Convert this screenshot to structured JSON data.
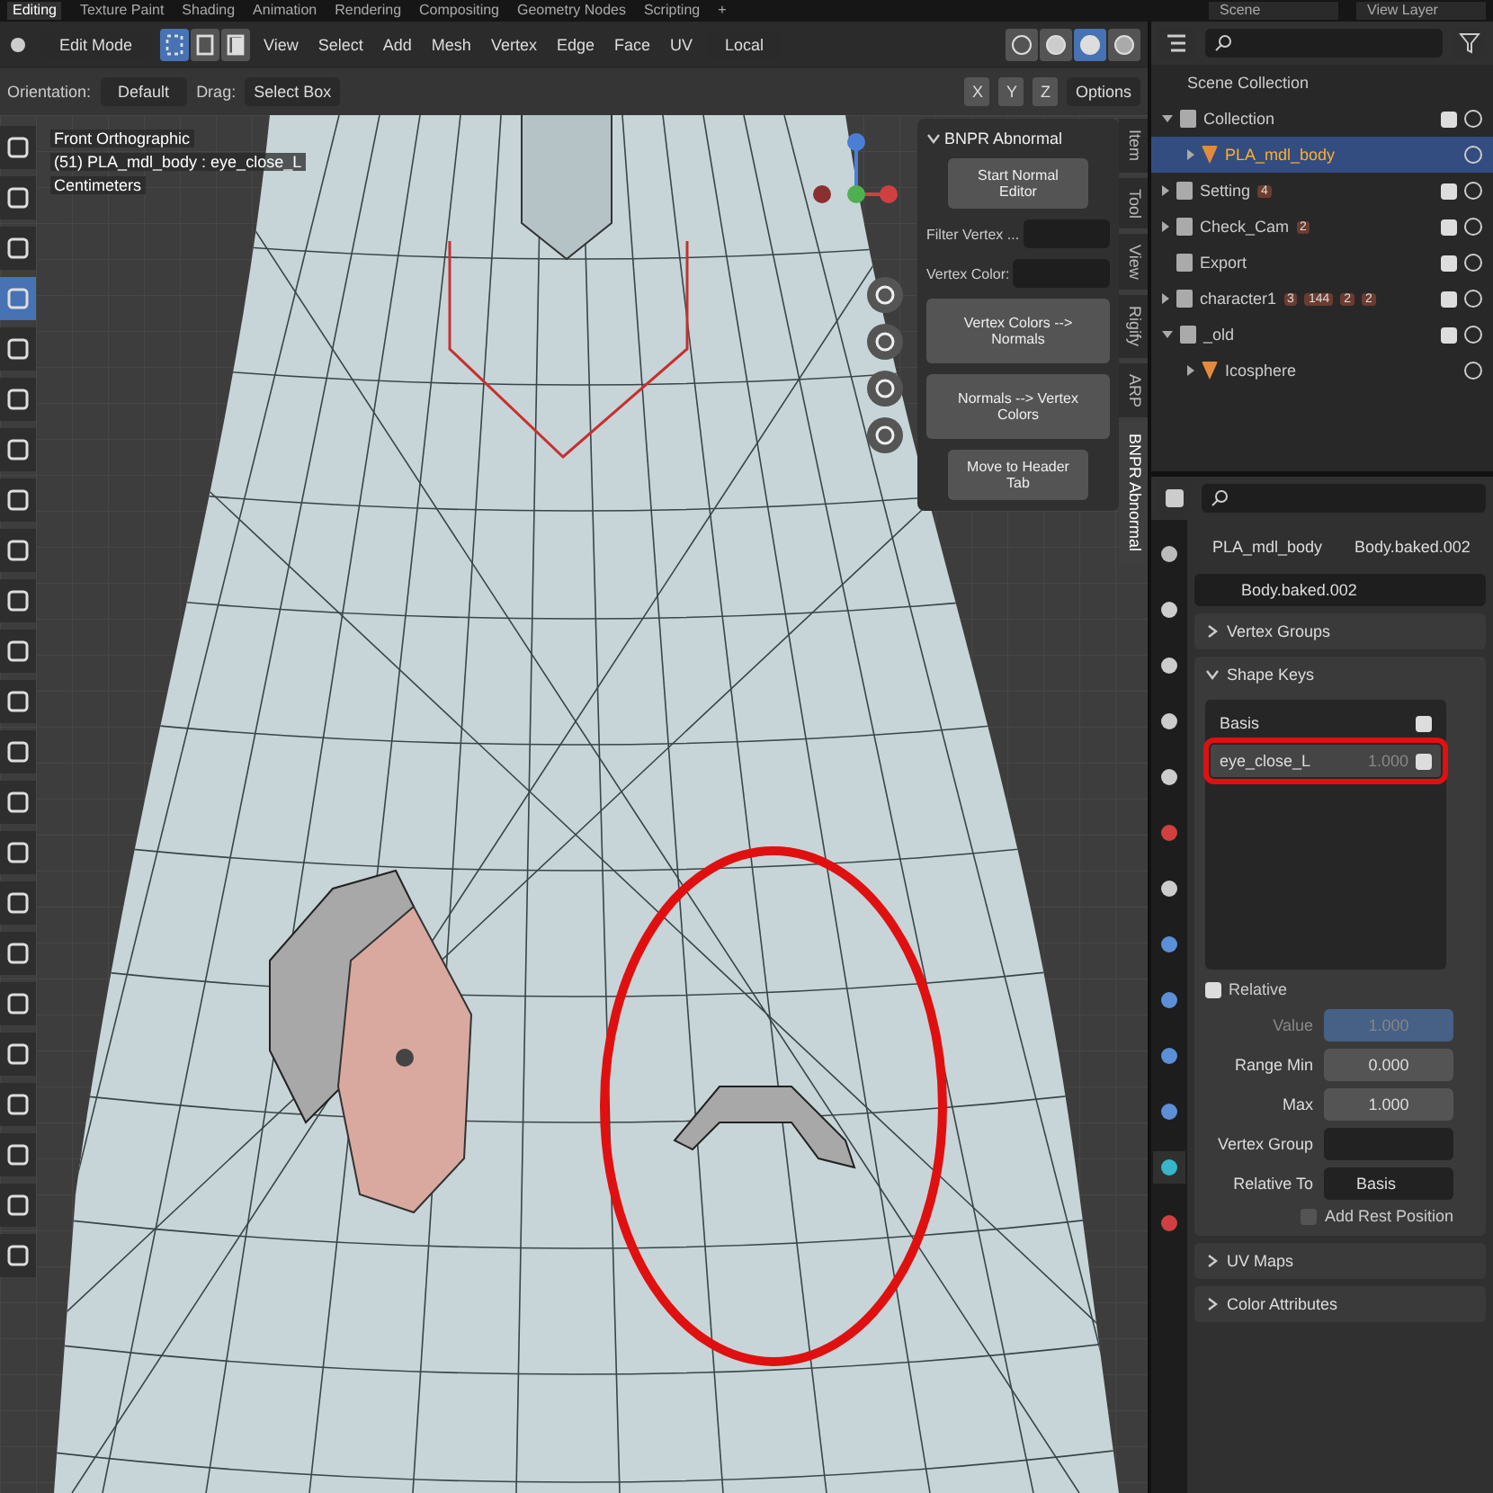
{
  "workspace_tabs": [
    {
      "label": "Editing",
      "selected": true
    },
    {
      "label": "Texture Paint",
      "selected": false
    },
    {
      "label": "Shading",
      "selected": false
    },
    {
      "label": "Animation",
      "selected": false
    },
    {
      "label": "Rendering",
      "selected": false
    },
    {
      "label": "Compositing",
      "selected": false
    },
    {
      "label": "Geometry Nodes",
      "selected": false
    },
    {
      "label": "Scripting",
      "selected": false
    },
    {
      "label": "+",
      "selected": false
    }
  ],
  "scene": "Scene",
  "view_layer": "View Layer",
  "viewport": {
    "mode": "Edit Mode",
    "select_modes": [
      {
        "kind": "vertex",
        "selected": true
      },
      {
        "kind": "edge",
        "selected": false
      },
      {
        "kind": "face",
        "selected": false
      }
    ],
    "menus": [
      "View",
      "Select",
      "Add",
      "Mesh",
      "Vertex",
      "Edge",
      "Face",
      "UV"
    ],
    "pivot": "Local",
    "shading": [
      {
        "kind": "wire",
        "selected": false
      },
      {
        "kind": "solid",
        "selected": false
      },
      {
        "kind": "material",
        "selected": true
      },
      {
        "kind": "rendered",
        "selected": false
      }
    ],
    "orientation_label": "Orientation:",
    "orientation": "Default",
    "drag_label": "Drag:",
    "drag": "Select Box",
    "axes": [
      "X",
      "Y",
      "Z"
    ],
    "options": "Options",
    "overlay_text": [
      "Front Orthographic",
      "(51) PLA_mdl_body : eye_close_L",
      "Centimeters"
    ],
    "tools": [
      {
        "selected": false
      },
      {
        "selected": false
      },
      {
        "selected": false
      },
      {
        "selected": true
      },
      {
        "selected": false
      },
      {
        "selected": false
      },
      {
        "selected": false
      },
      {
        "selected": false
      },
      {
        "selected": false
      },
      {
        "selected": false
      },
      {
        "selected": false
      },
      {
        "selected": false
      },
      {
        "selected": false
      },
      {
        "selected": false
      },
      {
        "selected": false
      },
      {
        "selected": false
      },
      {
        "selected": false
      },
      {
        "selected": false
      },
      {
        "selected": false
      },
      {
        "selected": false
      },
      {
        "selected": false
      },
      {
        "selected": false
      },
      {
        "selected": false
      }
    ],
    "n_panel": {
      "title": "BNPR Abnormal",
      "expanded": true,
      "rows": [
        {
          "kind": "small-button",
          "label": "Start Normal Editor"
        },
        {
          "kind": "field",
          "label": "Filter Vertex ..."
        },
        {
          "kind": "field",
          "label": "Vertex Color:"
        },
        {
          "kind": "button",
          "label": "Vertex Colors --> Normals"
        },
        {
          "kind": "button",
          "label": "Normals --> Vertex Colors"
        },
        {
          "kind": "small-button",
          "label": "Move to Header Tab"
        }
      ]
    },
    "side_tabs": [
      {
        "label": "Item",
        "selected": false
      },
      {
        "label": "Tool",
        "selected": false
      },
      {
        "label": "View",
        "selected": false
      },
      {
        "label": "Rigify",
        "selected": false
      },
      {
        "label": "ARP",
        "selected": false
      },
      {
        "label": "BNPR Abnormal",
        "selected": true
      }
    ]
  },
  "outliner": {
    "root": "Scene Collection",
    "items": [
      {
        "name": "Collection",
        "kind": "collection",
        "expanded": true,
        "selected": false,
        "checked": true,
        "children": [
          {
            "name": "PLA_mdl_body",
            "kind": "mesh",
            "expanded": false,
            "selected": true
          }
        ]
      },
      {
        "name": "Setting",
        "kind": "collection",
        "expanded": false,
        "selected": false,
        "checked": true,
        "badges": [
          "4"
        ]
      },
      {
        "name": "Check_Cam",
        "kind": "collection",
        "expanded": false,
        "selected": false,
        "checked": true,
        "badges": [
          "2"
        ]
      },
      {
        "name": "Export",
        "kind": "collection",
        "selected": false,
        "checked": true
      },
      {
        "name": "character1",
        "kind": "collection",
        "expanded": false,
        "selected": false,
        "checked": true,
        "badges": [
          "3",
          "144",
          "2",
          "2"
        ]
      },
      {
        "name": "_old",
        "kind": "collection",
        "expanded": true,
        "selected": false,
        "checked": true,
        "children": [
          {
            "name": "Icosphere",
            "kind": "mesh",
            "expanded": false,
            "selected": false
          }
        ]
      }
    ]
  },
  "properties": {
    "breadcrumb": [
      "PLA_mdl_body",
      "Body.baked.002"
    ],
    "mesh_name": "Body.baked.002",
    "tabs": [
      {
        "kind": "tool",
        "selected": false
      },
      {
        "kind": "render",
        "selected": false
      },
      {
        "kind": "output",
        "selected": false
      },
      {
        "kind": "view",
        "selected": false
      },
      {
        "kind": "scene",
        "selected": false
      },
      {
        "kind": "world",
        "selected": false
      },
      {
        "kind": "collection",
        "selected": false
      },
      {
        "kind": "modifier",
        "selected": false
      },
      {
        "kind": "particles",
        "selected": false
      },
      {
        "kind": "physics",
        "selected": false
      },
      {
        "kind": "constraint",
        "selected": false
      },
      {
        "kind": "data",
        "selected": true
      },
      {
        "kind": "material",
        "selected": false
      }
    ],
    "panels_before": [
      {
        "title": "Vertex Groups",
        "expanded": false
      }
    ],
    "shape_keys_title": "Shape Keys",
    "shape_keys_expanded": true,
    "shape_keys": [
      {
        "name": "Basis",
        "selected": false,
        "checked": true
      },
      {
        "name": "eye_close_L",
        "value": "1.000",
        "selected": true,
        "checked": true
      }
    ],
    "relative": {
      "label": "Relative",
      "checked": true
    },
    "fields": [
      {
        "label": "Value",
        "value": "1.000",
        "kind": "slider",
        "disabled": true
      },
      {
        "label": "Range Min",
        "value": "0.000",
        "kind": "number",
        "disabled": false
      },
      {
        "label": "Max",
        "value": "1.000",
        "kind": "number",
        "disabled": false
      },
      {
        "label": "Vertex Group",
        "kind": "group"
      },
      {
        "label": "Relative To",
        "value": "Basis",
        "kind": "key"
      }
    ],
    "rest_position": {
      "label": "Add Rest Position",
      "checked": false
    },
    "panels_after": [
      {
        "title": "UV Maps",
        "expanded": false
      },
      {
        "title": "Color Attributes",
        "expanded": false
      }
    ]
  }
}
